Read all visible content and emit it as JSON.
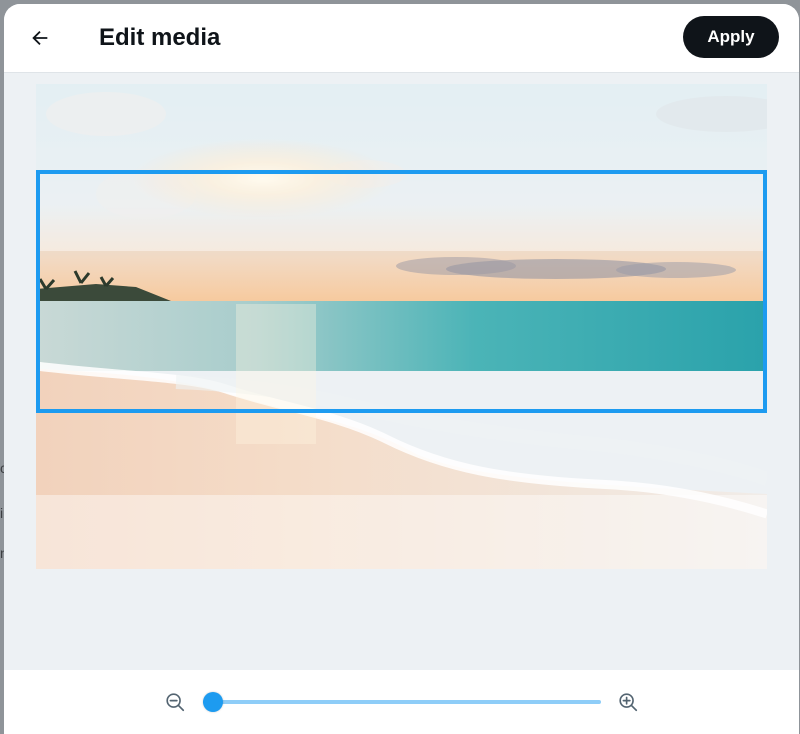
{
  "header": {
    "title": "Edit media",
    "back_icon": "arrow-left-icon",
    "apply_label": "Apply"
  },
  "media": {
    "description": "beach photo with sunset, waves and palm trees",
    "crop_aspect": "3:1"
  },
  "zoom": {
    "zoom_out_icon": "magnifier-minus-icon",
    "zoom_in_icon": "magnifier-plus-icon",
    "level": 0
  },
  "colors": {
    "accent": "#1d9bf0",
    "apply_bg": "#0f1419",
    "surface": "#edf1f4"
  }
}
